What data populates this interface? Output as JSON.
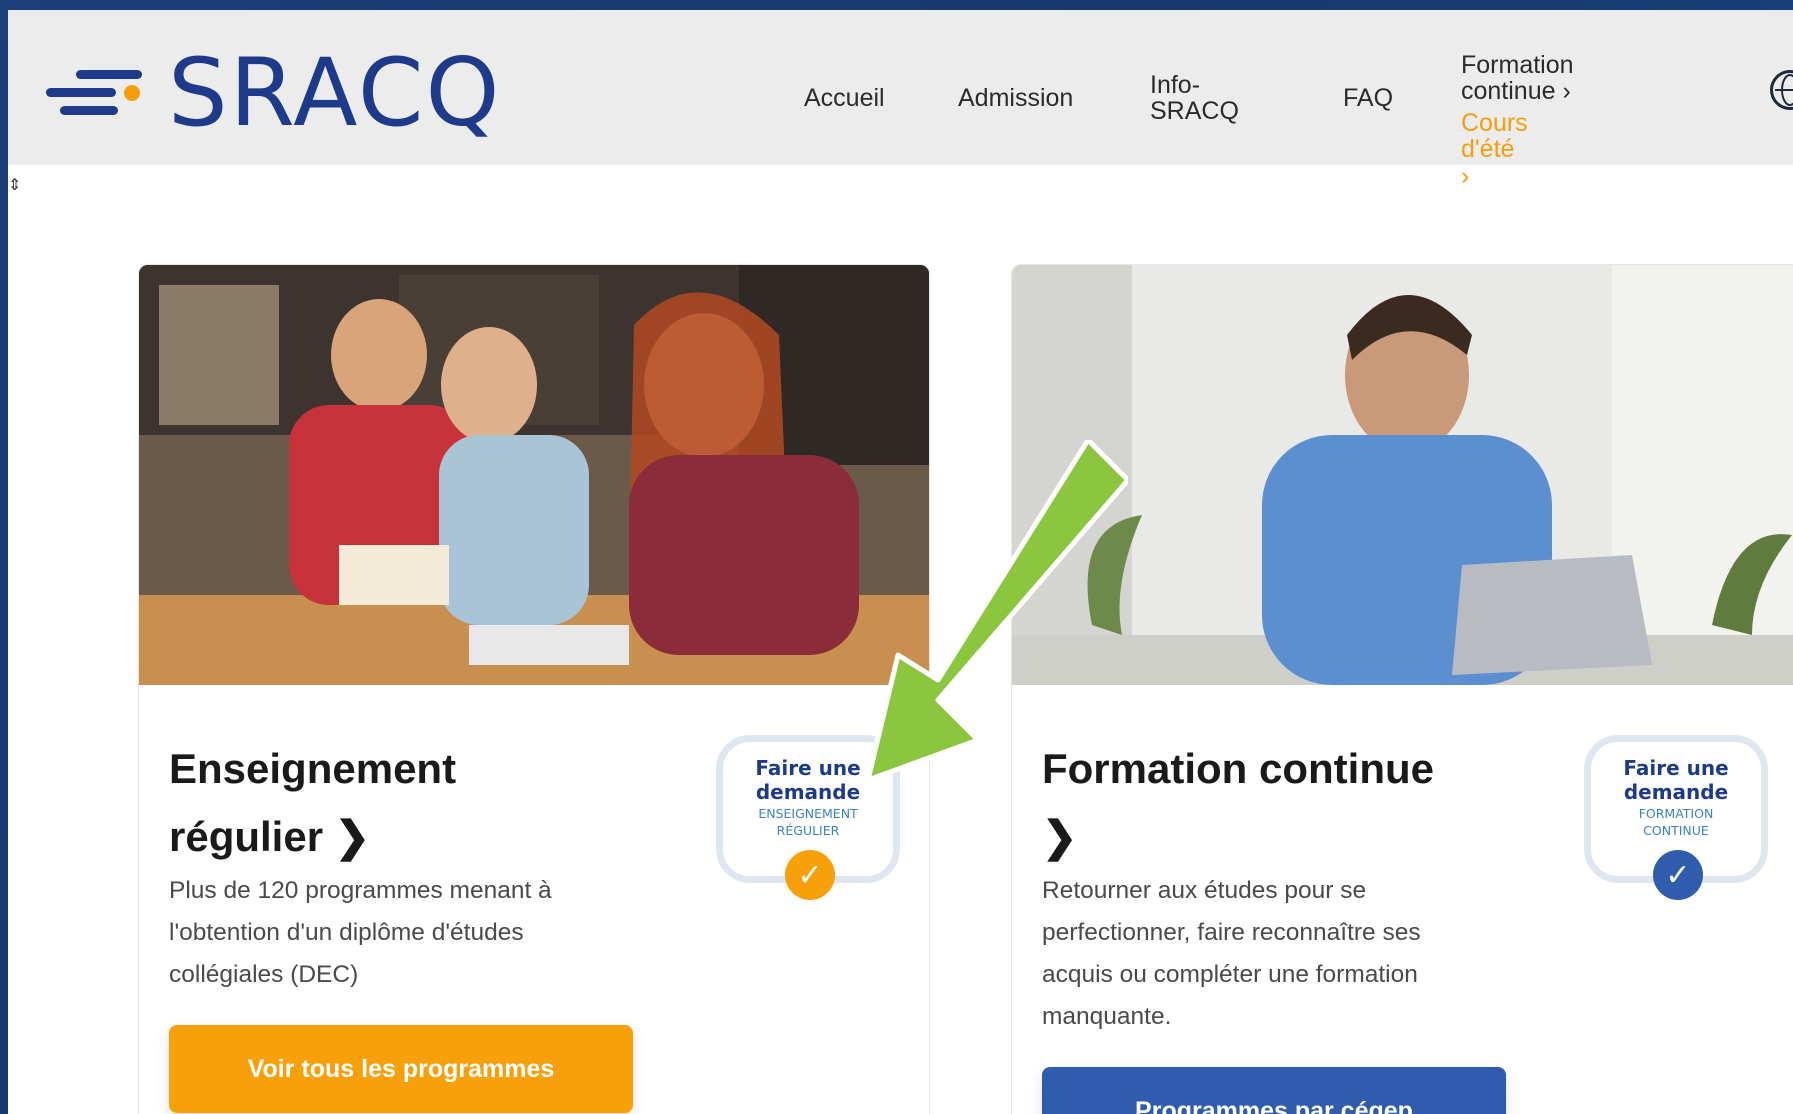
{
  "brand": {
    "name": "SRACQ",
    "colors": {
      "navy": "#1e3a8a",
      "orange": "#f59e0b",
      "blue": "#2f5cad",
      "green_arrow": "#8cc63f"
    }
  },
  "nav": {
    "accueil": "Accueil",
    "admission": "Admission",
    "info_line1": "Info-",
    "info_line2": "SRACQ",
    "faq": "FAQ",
    "formation_line1": "Formation",
    "formation_line2": "continue ›",
    "cours_ete": "Cours d'été ›",
    "language_icon": "globe-icon"
  },
  "cards": [
    {
      "title_line1": "Enseignement",
      "title_line2": "régulier ❯",
      "description": "Plus de 120 programmes menant à l'obtention d'un diplôme d'études collégiales (DEC)",
      "button": "Voir tous les programmes",
      "badge": {
        "line1": "Faire une",
        "line2": "demande",
        "sub1": "ENSEIGNEMENT",
        "sub2": "RÉGULIER",
        "icon": "check-hand-icon"
      }
    },
    {
      "title_line1": "Formation continue",
      "title_line2": "❯",
      "description": "Retourner aux études pour se perfectionner, faire reconnaître ses acquis ou compléter une formation manquante.",
      "button": "Programmes par cégep",
      "badge": {
        "line1": "Faire une",
        "line2": "demande",
        "sub1": "FORMATION",
        "sub2": "CONTINUE",
        "icon": "check-hand-icon"
      }
    }
  ]
}
